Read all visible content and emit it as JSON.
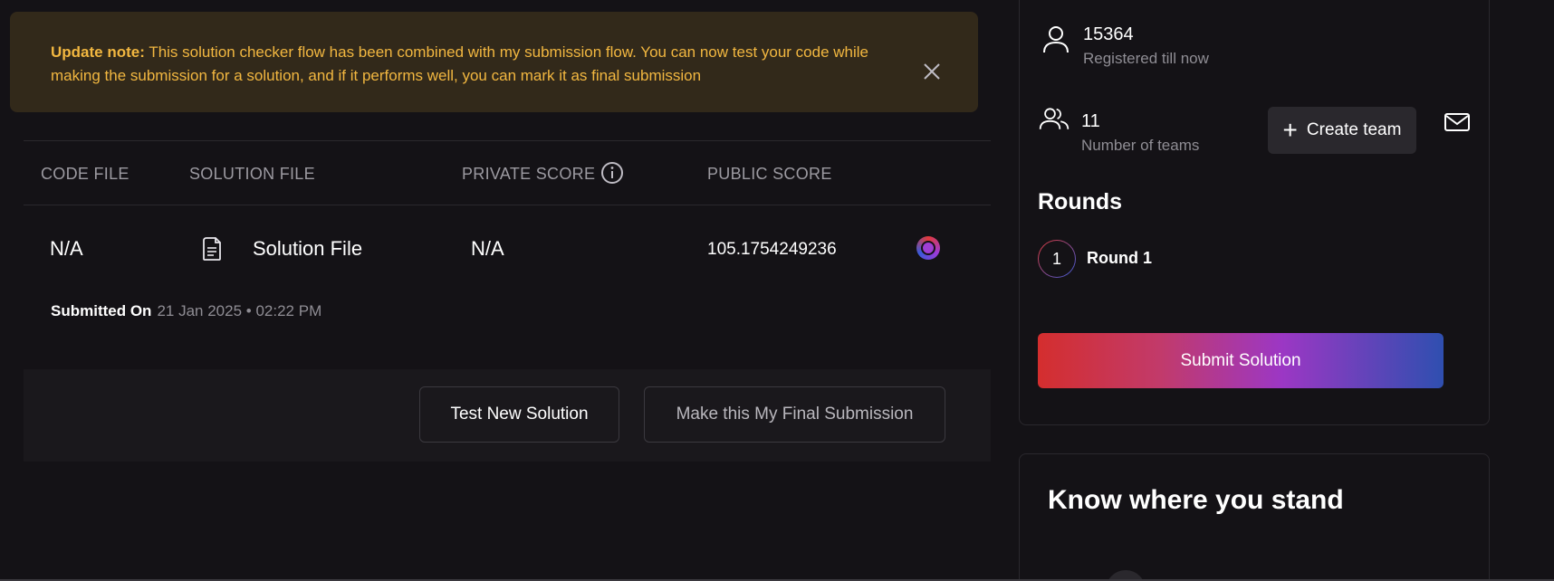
{
  "update_note": {
    "label": "Update note:",
    "text": "This solution checker flow has been combined with my submission flow. You can now test your code while making the submission for a solution, and if it performs well, you can mark it as final submission"
  },
  "table": {
    "headers": [
      "CODE FILE",
      "SOLUTION FILE",
      "PRIVATE SCORE",
      "PUBLIC SCORE"
    ],
    "row": {
      "code_file": "N/A",
      "solution_file": "Solution File",
      "private_score": "N/A",
      "public_score": "105.1754249236"
    },
    "submitted_label": "Submitted On",
    "submitted_date": "21 Jan 2025",
    "submitted_time": "02:22 PM"
  },
  "actions": {
    "test_label": "Test New Solution",
    "final_label": "Make this My Final Submission"
  },
  "sidebar": {
    "registered_count": "15364",
    "registered_label": "Registered till now",
    "teams_count": "11",
    "teams_label": "Number of teams",
    "create_team_label": "Create team",
    "rounds_title": "Rounds",
    "round_number": "1",
    "round_label": "Round 1",
    "submit_label": "Submit Solution",
    "stand_title": "Know where you stand"
  },
  "colors": {
    "background": "#141216",
    "note_bg": "#32291a",
    "note_text": "#f2b740",
    "gradient_start": "#d42e2e",
    "gradient_mid": "#9c37c4",
    "gradient_end": "#2f4fb0"
  },
  "icons": [
    "close-icon",
    "info-icon",
    "file-icon",
    "status-icon",
    "user-icon",
    "users-icon",
    "plus-icon",
    "mail-icon"
  ]
}
